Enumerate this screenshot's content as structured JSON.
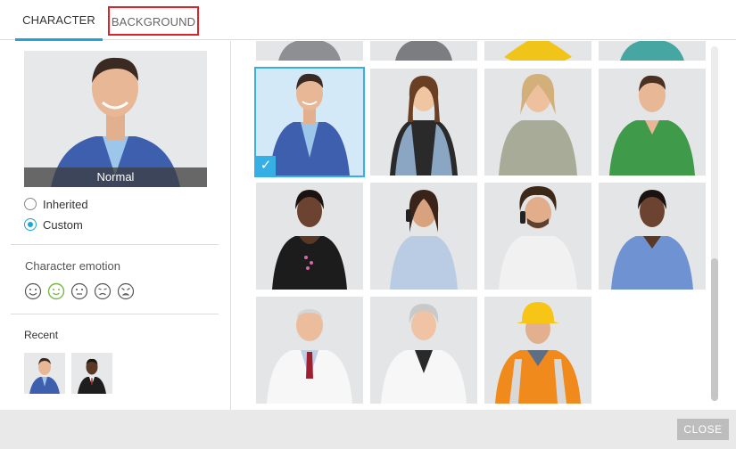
{
  "tabs": [
    {
      "label": "CHARACTER",
      "active": true
    },
    {
      "label": "BACKGROUND",
      "active": false
    }
  ],
  "preview": {
    "caption": "Normal"
  },
  "source_options": [
    {
      "label": "Inherited",
      "checked": false
    },
    {
      "label": "Custom",
      "checked": true
    }
  ],
  "emotion": {
    "title": "Character emotion",
    "icons": [
      "happy-face-icon",
      "smile-face-icon",
      "neutral-face-icon",
      "sad-face-icon",
      "angry-face-icon"
    ],
    "selected": "smile-face-icon"
  },
  "recent": {
    "title": "Recent"
  },
  "footer": {
    "close_label": "CLOSE"
  },
  "colors": {
    "accent": "#1fa4d6",
    "selected_tile": "#36b0e4",
    "highlight_border": "#e0222a"
  }
}
